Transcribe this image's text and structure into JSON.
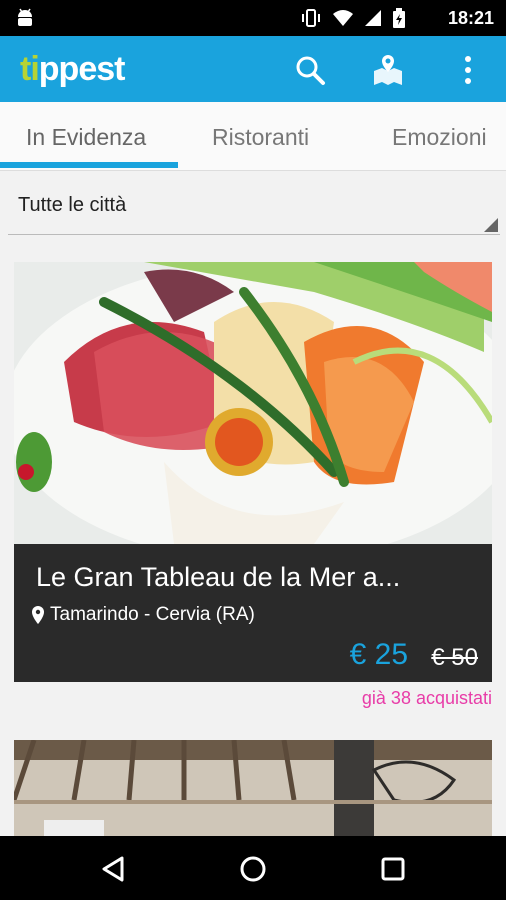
{
  "status_bar": {
    "time": "18:21",
    "icons": [
      "android-icon",
      "vibrate-icon",
      "wifi-icon",
      "signal-icon",
      "battery-icon"
    ]
  },
  "app_bar": {
    "logo_prefix": "ti",
    "logo_rest": "ppest",
    "actions": [
      "search-icon",
      "map-icon",
      "overflow-menu-icon"
    ],
    "colors": {
      "bar": "#1aa3dd",
      "logo_accent": "#b5d334"
    }
  },
  "tabs": [
    {
      "label": "In Evidenza",
      "active": true
    },
    {
      "label": "Ristoranti",
      "active": false
    },
    {
      "label": "Emozioni",
      "active": false
    }
  ],
  "city_select": {
    "value": "Tutte le città"
  },
  "deal": {
    "title": "Le Gran Tableau de la Mer a...",
    "location": "Tamarindo - Cervia (RA)",
    "price": "€ 25",
    "old_price": "€ 50",
    "purchased": "già 38 acquistati",
    "colors": {
      "price": "#1aa3dd",
      "purchased": "#e83ca8"
    }
  },
  "nav_bar": {
    "buttons": [
      "back-icon",
      "home-icon",
      "recents-icon"
    ]
  }
}
